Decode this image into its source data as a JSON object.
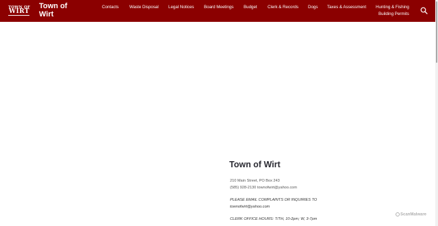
{
  "header": {
    "logo": {
      "line1": "TOWN OF",
      "line2": "WIRT"
    },
    "title": "Town of Wirt",
    "search_icon": "search-icon",
    "background": "#8b0000"
  },
  "nav": {
    "items": [
      {
        "label": "Contacts"
      },
      {
        "label": "Waste Disposal"
      },
      {
        "label": "Legal Notices"
      },
      {
        "label": "Board Meetings"
      },
      {
        "label": "Budget"
      },
      {
        "label": "Clerk & Records"
      },
      {
        "label": "Dogs"
      },
      {
        "label": "Taxes & Assessment"
      },
      {
        "label": "Hunting & Fishing"
      },
      {
        "label": "Building Permits"
      }
    ]
  },
  "info": {
    "title": "Town of Wirt",
    "address": "210 Main Street, PO Box 243",
    "phone_email": "(585) 928-2130 townofwirt@yahoo.com",
    "complaints_line1": "PLEASE EMAIL COMPLAINTS OR INQUIRIES TO",
    "complaints_line2": "townofwirt@yahoo.com",
    "hours": "CLERK OFFICE HOURS: T/TH, 10-2pm; W, 3-7pm"
  },
  "watermark": {
    "text": "ScanMalware"
  }
}
